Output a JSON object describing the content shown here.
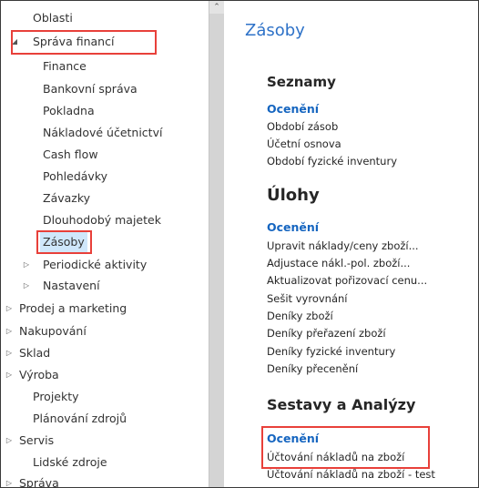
{
  "nav": {
    "items": [
      {
        "label": "Oblasti"
      },
      {
        "label": "Správa financí"
      },
      {
        "label": "Finance"
      },
      {
        "label": "Bankovní správa"
      },
      {
        "label": "Pokladna"
      },
      {
        "label": "Nákladové účetnictví"
      },
      {
        "label": "Cash flow"
      },
      {
        "label": "Pohledávky"
      },
      {
        "label": "Závazky"
      },
      {
        "label": "Dlouhodobý majetek"
      },
      {
        "label": "Zásoby"
      },
      {
        "label": "Periodické aktivity"
      },
      {
        "label": "Nastavení"
      },
      {
        "label": "Prodej a marketing"
      },
      {
        "label": "Nakupování"
      },
      {
        "label": "Sklad"
      },
      {
        "label": "Výroba"
      },
      {
        "label": "Projekty"
      },
      {
        "label": "Plánování zdrojů"
      },
      {
        "label": "Servis"
      },
      {
        "label": "Lidské zdroje"
      },
      {
        "label": "Správa"
      }
    ]
  },
  "content": {
    "title": "Zásoby",
    "sections": [
      {
        "title": "Seznamy",
        "group": "Ocenění",
        "links": [
          "Období zásob",
          "Účetní osnova",
          "Období fyzické inventury"
        ]
      },
      {
        "title": "Úlohy",
        "group": "Ocenění",
        "links": [
          "Upravit náklady/ceny zboží...",
          "Adjustace nákl.-pol. zboží...",
          "Aktualizovat pořizovací cenu...",
          "Sešit vyrovnání",
          "Deníky zboží",
          "Deníky přeřazení zboží",
          "Deníky fyzické inventury",
          "Deníky přecenění"
        ]
      },
      {
        "title": "Sestavy a Analýzy",
        "group": "Ocenění",
        "links": [
          "Účtování nákladů na zboží",
          "Účtování nákladů na zboží - test"
        ]
      }
    ]
  },
  "colors": {
    "accent": "#2e72c8",
    "group_link": "#1565c0",
    "selection": "#cfe7fb",
    "highlight_box": "#e8403a",
    "scrollbar": "#d4d4d4"
  },
  "icons": {
    "expanded": "triangle-down-icon",
    "collapsed": "triangle-right-icon",
    "scroll_up": "chevron-up-icon"
  }
}
